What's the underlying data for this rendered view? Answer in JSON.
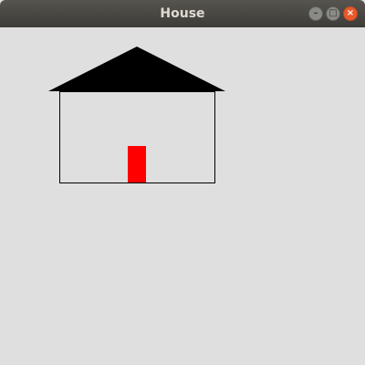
{
  "window": {
    "title": "House",
    "controls": {
      "minimize_glyph": "–",
      "maximize_glyph": "□",
      "close_glyph": "×"
    }
  },
  "colors": {
    "titlebar": "#45443f",
    "canvas_background": "#dfdfdf",
    "roof": "#000000",
    "wall_outline": "#000000",
    "door": "#ff0000",
    "close_button": "#e9592d"
  },
  "drawing": {
    "shapes": [
      "roof",
      "wall",
      "door"
    ]
  }
}
